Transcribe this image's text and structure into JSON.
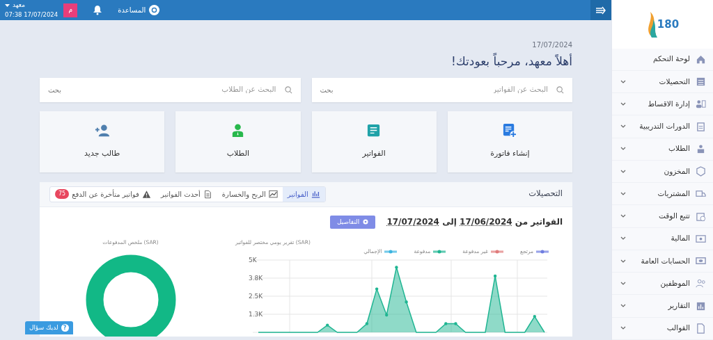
{
  "header": {
    "user_name": "معهد",
    "datetime": "07:38 17/07/2024",
    "avatar_letter": "م",
    "help_label": "المساعدة"
  },
  "sidebar": {
    "items": [
      {
        "label": "لوحة التحكم",
        "has_submenu": false
      },
      {
        "label": "التحصيلات",
        "has_submenu": true
      },
      {
        "label": "إدارة الاقساط",
        "has_submenu": true
      },
      {
        "label": "الدورات التدريبية",
        "has_submenu": true
      },
      {
        "label": "الطلاب",
        "has_submenu": true
      },
      {
        "label": "المخزون",
        "has_submenu": true
      },
      {
        "label": "المشتريات",
        "has_submenu": true
      },
      {
        "label": "تتبع الوقت",
        "has_submenu": true
      },
      {
        "label": "المالية",
        "has_submenu": true
      },
      {
        "label": "الحسابات العامة",
        "has_submenu": true
      },
      {
        "label": "الموظفين",
        "has_submenu": true
      },
      {
        "label": "التقارير",
        "has_submenu": true
      },
      {
        "label": "القوالب",
        "has_submenu": true
      }
    ]
  },
  "date": "17/07/2024",
  "greeting": "أهلاً معهد، مرحباً بعودتك!",
  "searches": [
    {
      "placeholder": "البحث عن الفواتير",
      "button": "بحث"
    },
    {
      "placeholder": "البحث عن الطلاب",
      "button": "بحث"
    }
  ],
  "quick_actions": [
    {
      "label": "إنشاء فاتورة"
    },
    {
      "label": "الفواتير"
    },
    {
      "label": "الطلاب"
    },
    {
      "label": "طالب جديد"
    }
  ],
  "collections": {
    "title": "التحصيلات",
    "tabs": [
      {
        "label": "الفواتير",
        "selected": true
      },
      {
        "label": "الربح والخسارة",
        "selected": false
      },
      {
        "label": "أحدث الفواتير",
        "selected": false
      },
      {
        "label": "فواتير متأخرة عن الدفع",
        "selected": false,
        "badge": "75"
      }
    ],
    "range_prefix": "الفواتير من",
    "range_from": "17/06/2024",
    "range_joiner": "إلى",
    "range_to": "17/07/2024",
    "details_button": "التفاصيل",
    "daily_chart": {
      "chart_data": {
        "type": "area",
        "grid": true,
        "title": "(SAR) تقرير يومي مختصر للفواتير",
        "yticks": [
          {
            "value": 1250,
            "label": "1.3K"
          },
          {
            "value": 2500,
            "label": "2.5K"
          },
          {
            "value": 3750,
            "label": "3.8K"
          },
          {
            "value": 5000,
            "label": "5K"
          }
        ],
        "ylim": [
          0,
          5000
        ],
        "series": [
          {
            "name": "مرتجع",
            "color": "#6f7de0",
            "values": [
              null,
              null,
              null,
              null,
              null,
              null,
              null,
              null,
              null,
              null,
              null,
              null,
              null,
              null,
              null,
              null,
              null,
              null,
              null,
              null,
              null,
              null,
              null,
              null,
              null,
              null,
              null,
              null,
              null,
              null
            ]
          },
          {
            "name": "غير مدفوعة",
            "color": "#e07b7b",
            "values": [
              null,
              null,
              null,
              null,
              null,
              null,
              null,
              null,
              null,
              null,
              null,
              null,
              null,
              null,
              null,
              null,
              null,
              null,
              null,
              null,
              null,
              null,
              null,
              null,
              null,
              null,
              null,
              null,
              null,
              null
            ]
          },
          {
            "name": "مدفوعة",
            "color": "#1fb592",
            "values": [
              0,
              0,
              0,
              0,
              0,
              0,
              0,
              500,
              0,
              0,
              0,
              600,
              3000,
              1200,
              4500,
              2100,
              0,
              0,
              0,
              600,
              600,
              0,
              0,
              0,
              3900,
              0,
              0,
              0,
              1100,
              0
            ]
          },
          {
            "name": "الإجمالي",
            "color": "#3bb4e0",
            "values": [
              null,
              null,
              null,
              null,
              null,
              null,
              null,
              null,
              null,
              null,
              null,
              null,
              null,
              null,
              null,
              null,
              null,
              null,
              null,
              null,
              null,
              null,
              null,
              null,
              null,
              null,
              null,
              null,
              null,
              null
            ]
          }
        ]
      }
    },
    "payments_title": "(SAR) ملخص المدفوعات"
  },
  "help_button": "لديك سؤال",
  "help_icon": "?",
  "logo_text": "180"
}
